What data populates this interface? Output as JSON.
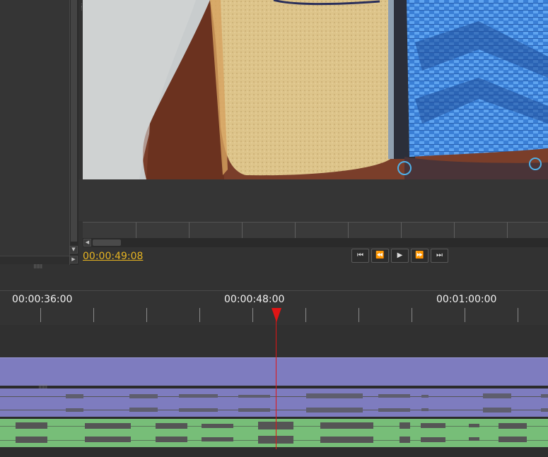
{
  "player": {
    "current_time": "00:00:49:08",
    "controls": {
      "go_to_start": "⏮",
      "rewind": "⏪",
      "play": "▶",
      "fast_forward": "⏩",
      "go_to_end": "⏭"
    }
  },
  "timeline": {
    "ruler_labels": [
      "00:00:36:00",
      "00:00:48:00",
      "00:01:00:00"
    ]
  },
  "colors": {
    "timecode": "#e6b422",
    "playhead": "#e01515",
    "video_track": "#7e7cbf",
    "audio_track_a": "#7e7cbf",
    "audio_track_b": "#77be78"
  }
}
